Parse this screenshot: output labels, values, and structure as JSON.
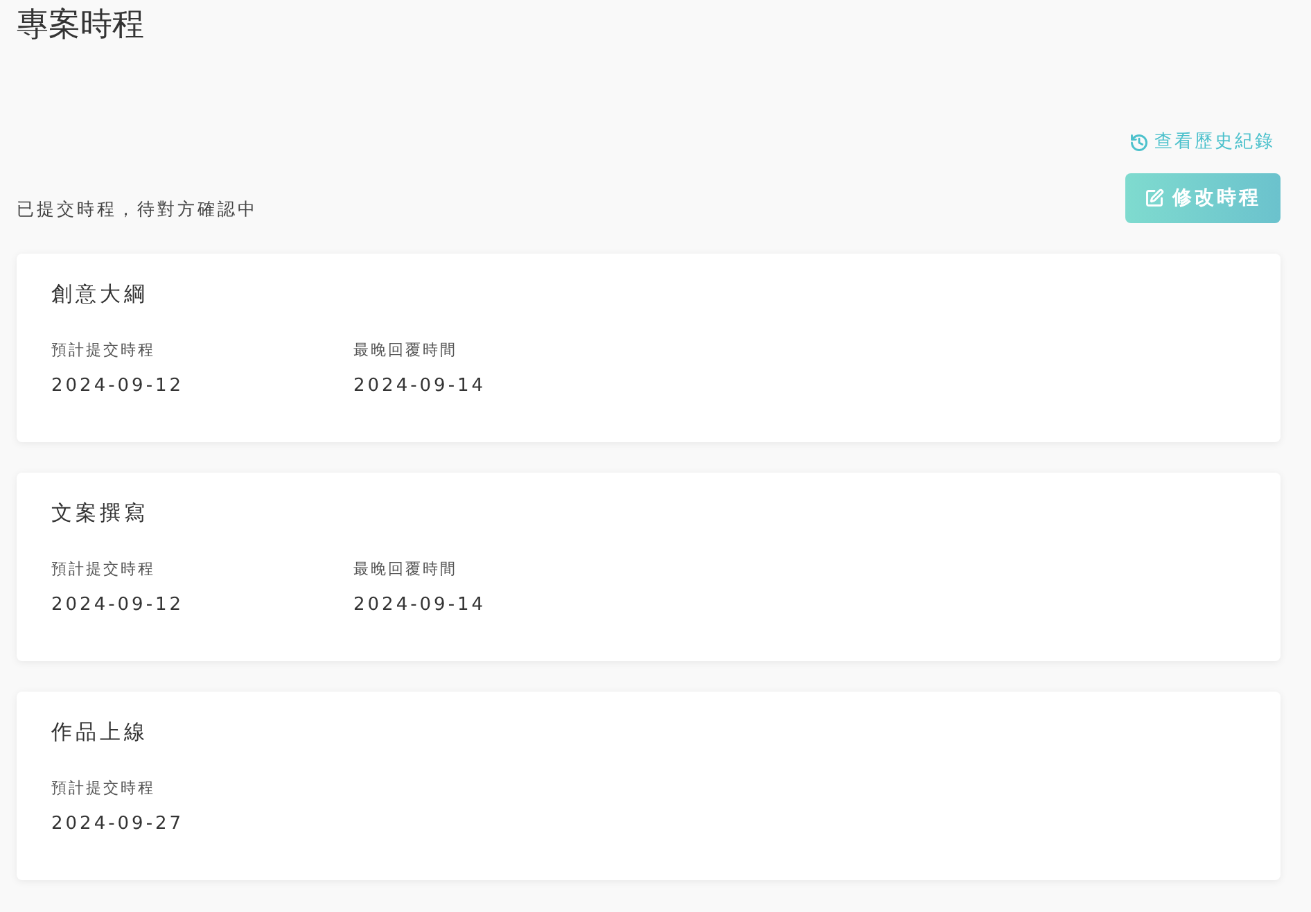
{
  "page": {
    "title": "專案時程"
  },
  "history_link": {
    "label": "查看歷史紀錄"
  },
  "status": "已提交時程，待對方確認中",
  "edit_button": {
    "label": "修改時程"
  },
  "milestones": [
    {
      "title": "創意大綱",
      "fields": [
        {
          "label": "預計提交時程",
          "value": "2024-09-12"
        },
        {
          "label": "最晚回覆時間",
          "value": "2024-09-14"
        }
      ]
    },
    {
      "title": "文案撰寫",
      "fields": [
        {
          "label": "預計提交時程",
          "value": "2024-09-12"
        },
        {
          "label": "最晚回覆時間",
          "value": "2024-09-14"
        }
      ]
    },
    {
      "title": "作品上線",
      "fields": [
        {
          "label": "預計提交時程",
          "value": "2024-09-27"
        }
      ]
    }
  ]
}
